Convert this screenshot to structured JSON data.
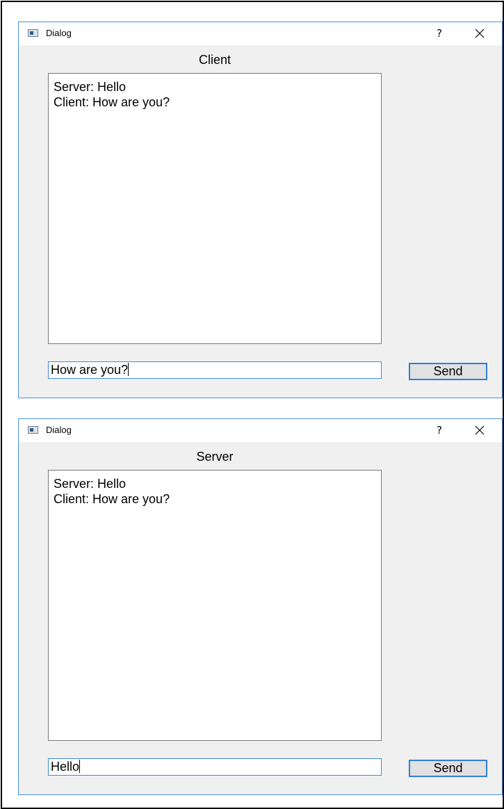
{
  "dialogs": [
    {
      "window_title": "Dialog",
      "help_label": "?",
      "heading": "Client",
      "messages": [
        "Server: Hello",
        "Client: How are you?"
      ],
      "input_value": "How are you?",
      "send_label": "Send"
    },
    {
      "window_title": "Dialog",
      "help_label": "?",
      "heading": "Server",
      "messages": [
        "Server: Hello",
        "Client: How are you?"
      ],
      "input_value": "Hello",
      "send_label": "Send"
    }
  ],
  "icons": {
    "app": "app-window-icon",
    "help": "question-mark",
    "close": "close-x"
  },
  "colors": {
    "dialog_background": "#f0f0f0",
    "titlebar_background": "#ffffff",
    "focus_border": "#3c8ad8",
    "button_background": "#e1e1e1"
  }
}
